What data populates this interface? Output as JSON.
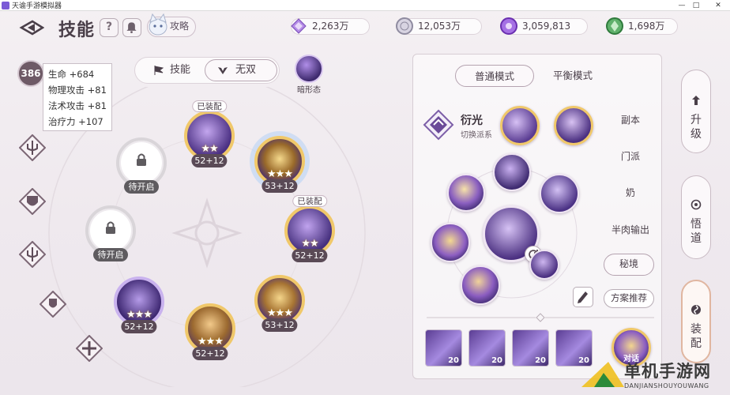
{
  "window": {
    "title": "天谕手游模拟器",
    "minimize": "—",
    "maximize": "□",
    "close": "✕"
  },
  "header": {
    "title": "技能",
    "help_label": "?",
    "strategy_label": "攻略"
  },
  "resources": [
    {
      "name": "purple-crystal",
      "value": "2,263万",
      "color": "#9a6bd0"
    },
    {
      "name": "silver-coin",
      "value": "12,053万",
      "color": "#8f8ba0"
    },
    {
      "name": "violet-gem",
      "value": "3,059,813",
      "color": "#8a4fd4"
    },
    {
      "name": "green-gem",
      "value": "1,698万",
      "color": "#4e9a5a"
    }
  ],
  "player": {
    "level": "386",
    "stats": [
      "生命 +684",
      "物理攻击 +81",
      "法术攻击 +81",
      "治疗力 +107"
    ]
  },
  "mode_tabs": {
    "skill_label": "技能",
    "wushuang_label": "无双",
    "active": "无双"
  },
  "anxing_label": "暗形态",
  "skill_nodes": [
    {
      "id": "n1",
      "level": "52+12",
      "tag": "已装配",
      "stars": 2
    },
    {
      "id": "n2",
      "level": "53+12",
      "stars": 3
    },
    {
      "id": "n3",
      "level": "52+12",
      "tag": "已装配",
      "stars": 2
    },
    {
      "id": "n4",
      "level": "53+12",
      "stars": 3
    },
    {
      "id": "n5",
      "level": "52+12",
      "stars": 3
    },
    {
      "id": "n6",
      "level": "52+12",
      "stars": 3
    },
    {
      "id": "locked1",
      "level": "待开启"
    },
    {
      "id": "locked2",
      "level": "待开启"
    }
  ],
  "panel": {
    "tab_normal": "普通模式",
    "tab_balanced": "平衡模式",
    "build_name": "衍光",
    "build_sub": "切换派系",
    "categories": [
      "副本",
      "门派",
      "奶",
      "半肉输出",
      "秘境"
    ],
    "active_category": "秘境",
    "plan_label": "方案推荐",
    "cards": [
      {
        "count": "20"
      },
      {
        "count": "20"
      },
      {
        "count": "20"
      },
      {
        "count": "20"
      }
    ],
    "last_card_label": "对话"
  },
  "side_buttons": [
    {
      "label_1": "升",
      "label_2": "级"
    },
    {
      "label_1": "悟",
      "label_2": "道"
    },
    {
      "label_1": "装",
      "label_2": "配"
    }
  ],
  "watermark": {
    "text": "单机手游网",
    "sub": "DANJIANSHOUYOUWANG"
  }
}
